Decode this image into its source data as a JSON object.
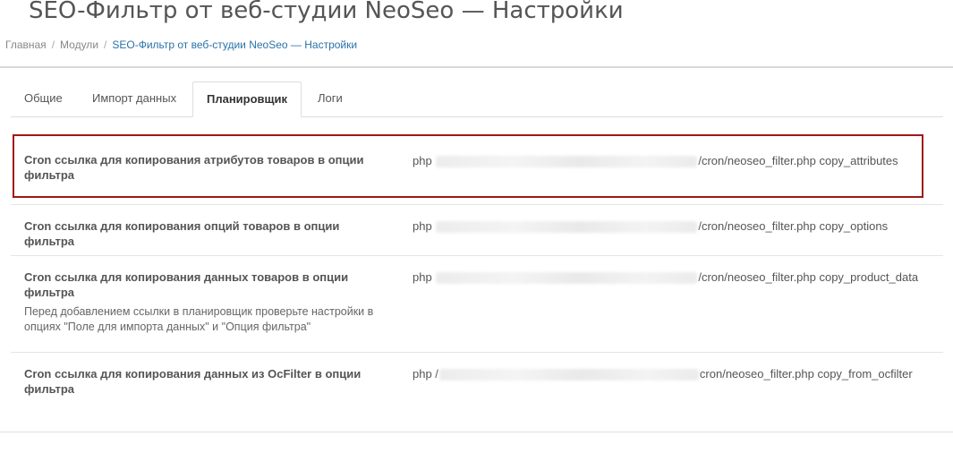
{
  "page": {
    "title": "SEO-Фильтр от веб-студии NeoSeo — Настройки"
  },
  "breadcrumb": {
    "items": [
      "Главная",
      "Модули",
      "SEO-Фильтр от веб-студии NeoSeo — Настройки"
    ]
  },
  "tabs": [
    {
      "label": "Общие",
      "active": false
    },
    {
      "label": "Импорт данных",
      "active": false
    },
    {
      "label": "Планировщик",
      "active": true
    },
    {
      "label": "Логи",
      "active": false
    }
  ],
  "cron_rows": [
    {
      "label": "Cron ссылка для копирования атрибутов товаров в опции фильтра",
      "hint": "",
      "cmd_prefix": "php",
      "cmd_suffix": "/cron/neoseo_filter.php copy_attributes",
      "highlighted": true
    },
    {
      "label": "Cron ссылка для копирования опций товаров в опции фильтра",
      "hint": "",
      "cmd_prefix": "php",
      "cmd_suffix": "/cron/neoseo_filter.php copy_options",
      "highlighted": false
    },
    {
      "label": "Cron ссылка для копирования данных товаров в опции фильтра",
      "hint": "Перед добавлением ссылки в планировщик проверьте настройки в опциях \"Поле для импорта данных\" и \"Опция фильтра\"",
      "cmd_prefix": "php",
      "cmd_suffix": "/cron/neoseo_filter.php copy_product_data",
      "highlighted": false
    },
    {
      "label": "Cron ссылка для копирования данных из OcFilter в опции фильтра",
      "hint": "",
      "cmd_prefix": "php /",
      "cmd_suffix": "cron/neoseo_filter.php copy_from_ocfilter",
      "highlighted": false
    }
  ],
  "colors": {
    "highlight_border": "#a01818",
    "breadcrumb_active": "#2a72a8"
  }
}
